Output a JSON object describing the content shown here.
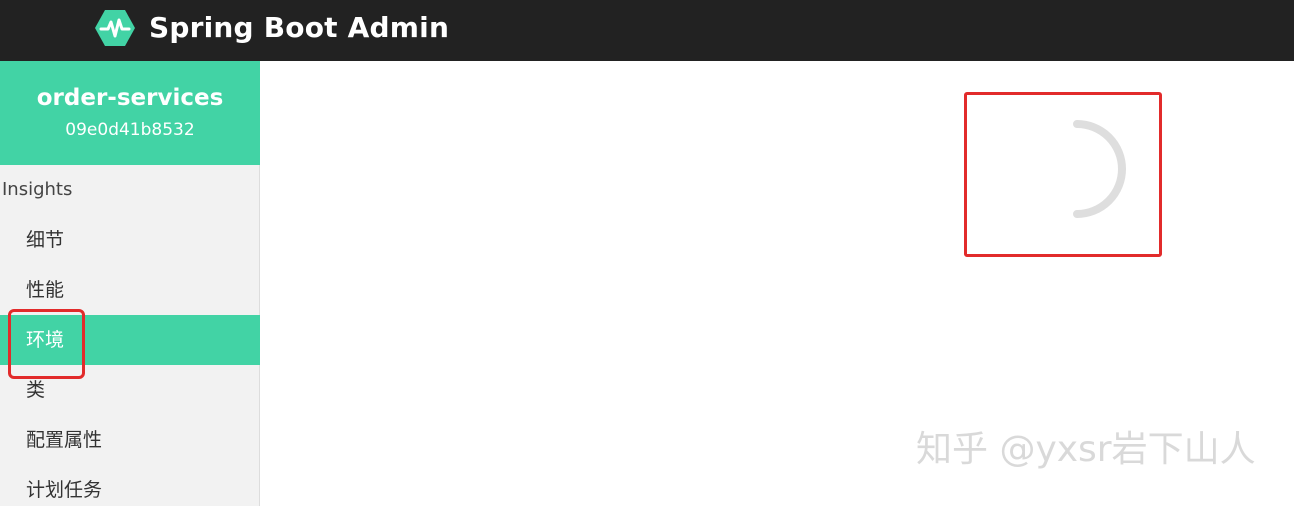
{
  "header": {
    "title": "Spring Boot Admin",
    "logo_icon": "heartbeat-hexagon-icon",
    "background": "#222222"
  },
  "sidebar": {
    "app_name": "order-services",
    "app_id": "09e0d41b8532",
    "section": "Insights",
    "accent": "#42d3a5",
    "items": [
      {
        "label": "细节",
        "active": false
      },
      {
        "label": "性能",
        "active": false
      },
      {
        "label": "环境",
        "active": true
      },
      {
        "label": "类",
        "active": false
      },
      {
        "label": "配置属性",
        "active": false
      },
      {
        "label": "计划任务",
        "active": false
      }
    ]
  },
  "main": {
    "loading_icon": "loading-spinner-icon",
    "annotation_color": "#e22b2b"
  },
  "watermark": "知乎 @yxsr岩下山人"
}
